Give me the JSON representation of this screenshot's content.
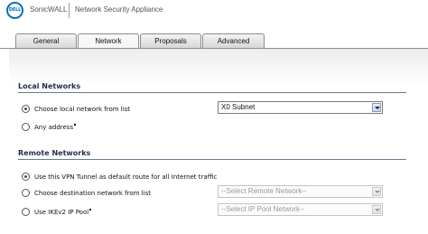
{
  "header": {
    "logo_text": "DELL",
    "brand": "SonicWALL",
    "app_title": "Network Security Appliance"
  },
  "tabs": [
    {
      "label": "General",
      "active": false
    },
    {
      "label": "Network",
      "active": true
    },
    {
      "label": "Proposals",
      "active": false
    },
    {
      "label": "Advanced",
      "active": false
    }
  ],
  "local_networks": {
    "title": "Local Networks",
    "choose_label": "Choose local network from list",
    "choose_checked": true,
    "selected_value": "X0 Subnet",
    "any_label": "Any address",
    "any_checked": false
  },
  "remote_networks": {
    "title": "Remote Networks",
    "default_route_label": "Use this VPN Tunnel as default route for all Internet traffic",
    "default_route_checked": true,
    "choose_dest_label": "Choose destination network from list",
    "choose_dest_checked": false,
    "remote_select_value": "--Select Remote Network--",
    "ikev2_label": "Use IKEv2 IP Pool",
    "ikev2_checked": false,
    "ip_pool_select_value": "--Select IP Pool Network--"
  },
  "colors": {
    "dell_blue": "#0a70b8",
    "section_title": "#1f2f48"
  }
}
